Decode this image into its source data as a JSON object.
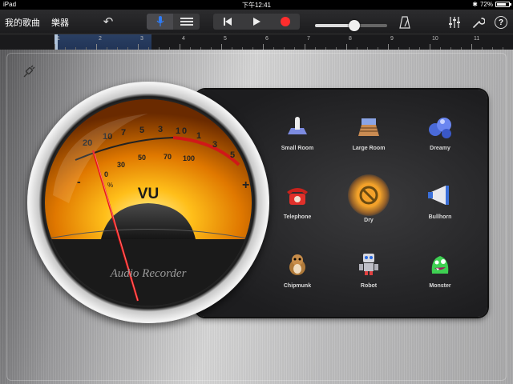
{
  "status": {
    "device": "iPad",
    "time": "下午12:41",
    "battery": "72%"
  },
  "toolbar": {
    "my_songs": "我的歌曲",
    "instruments": "樂器",
    "undo_icon": "undo-icon",
    "mic_icon": "microphone-icon",
    "tracks_icon": "tracks-view-icon",
    "rewind_icon": "rewind-icon",
    "play_icon": "play-icon",
    "record_icon": "record-icon",
    "metronome_icon": "metronome-icon",
    "mixer_icon": "mixer-icon",
    "settings_icon": "wrench-icon",
    "help_label": "?"
  },
  "ruler": {
    "marks": [
      "1",
      "2",
      "3",
      "4",
      "5",
      "6",
      "7",
      "8",
      "9",
      "10",
      "11"
    ]
  },
  "vu_meter": {
    "label": "VU",
    "brand": "Audio Recorder",
    "top_scale": [
      "20",
      "10",
      "7",
      "5",
      "3",
      "1",
      "0",
      "1",
      "3",
      "5"
    ],
    "bottom_scale": [
      "0",
      "30",
      "50",
      "70",
      "100"
    ],
    "minus": "-",
    "plus": "+",
    "percent": "%"
  },
  "effects": [
    {
      "label": "Small Room",
      "icon": "small-room-icon"
    },
    {
      "label": "Large Room",
      "icon": "large-room-icon"
    },
    {
      "label": "Dreamy",
      "icon": "dreamy-icon"
    },
    {
      "label": "Telephone",
      "icon": "telephone-icon"
    },
    {
      "label": "Dry",
      "icon": "dry-icon",
      "selected": true
    },
    {
      "label": "Bullhorn",
      "icon": "bullhorn-icon"
    },
    {
      "label": "Chipmunk",
      "icon": "chipmunk-icon"
    },
    {
      "label": "Robot",
      "icon": "robot-icon"
    },
    {
      "label": "Monster",
      "icon": "monster-icon"
    }
  ],
  "colors": {
    "record": "#ff2d2d",
    "accent_blue": "#2f7cf6",
    "dry_glow": "#ff9a1a"
  }
}
